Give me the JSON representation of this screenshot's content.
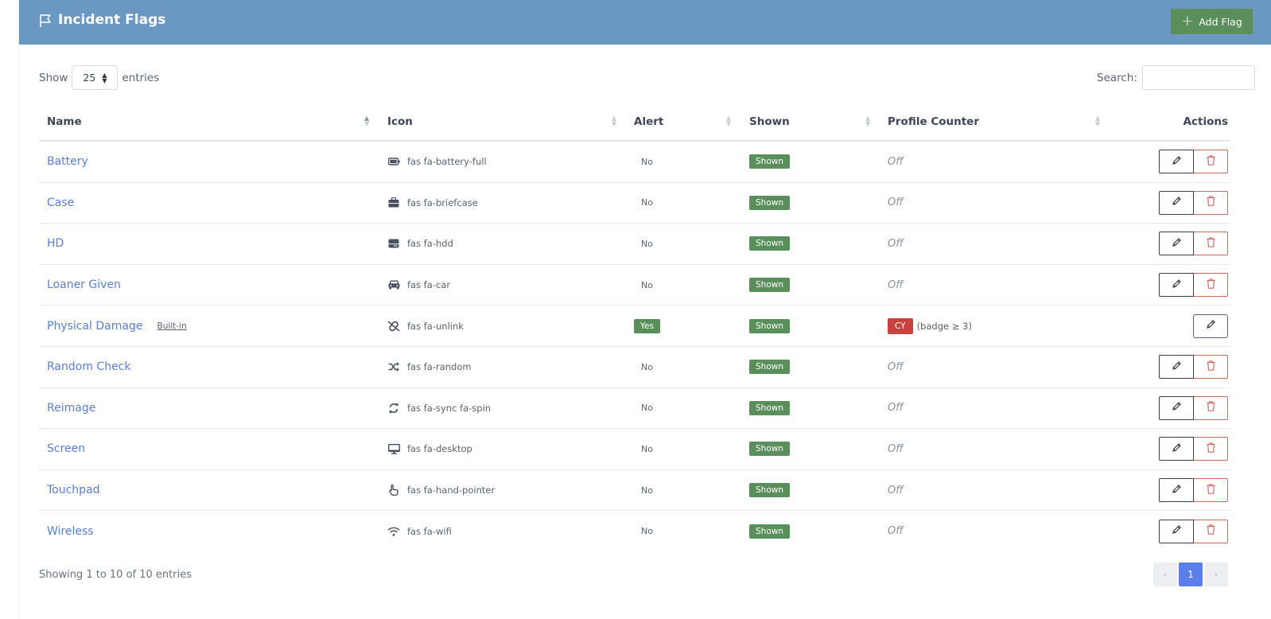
{
  "header": {
    "title": "Incident Flags",
    "add_label": "Add Flag"
  },
  "length_menu": {
    "show_label": "Show",
    "value": "25",
    "entries_label": "entries"
  },
  "search": {
    "label": "Search:",
    "value": ""
  },
  "columns": [
    "Name",
    "Icon",
    "Alert",
    "Shown",
    "Profile Counter",
    "Actions"
  ],
  "rows": [
    {
      "name": "Battery",
      "builtin": "",
      "icon_name": "battery-full-icon",
      "icon": "fas fa-battery-full",
      "alert": "No",
      "shown": "Shown",
      "profile": "Off",
      "deletable": true
    },
    {
      "name": "Case",
      "builtin": "",
      "icon_name": "briefcase-icon",
      "icon": "fas fa-briefcase",
      "alert": "No",
      "shown": "Shown",
      "profile": "Off",
      "deletable": true
    },
    {
      "name": "HD",
      "builtin": "",
      "icon_name": "hdd-icon",
      "icon": "fas fa-hdd",
      "alert": "No",
      "shown": "Shown",
      "profile": "Off",
      "deletable": true
    },
    {
      "name": "Loaner Given",
      "builtin": "",
      "icon_name": "car-icon",
      "icon": "fas fa-car",
      "alert": "No",
      "shown": "Shown",
      "profile": "Off",
      "deletable": true
    },
    {
      "name": "Physical Damage",
      "builtin": "Built-in",
      "icon_name": "unlink-icon",
      "icon": "fas fa-unlink",
      "alert": "Yes",
      "shown": "Shown",
      "profile": "",
      "profile_badge": "CY",
      "profile_note": "(badge ≥ 3)",
      "deletable": false
    },
    {
      "name": "Random Check",
      "builtin": "",
      "icon_name": "random-icon",
      "icon": "fas fa-random",
      "alert": "No",
      "shown": "Shown",
      "profile": "Off",
      "deletable": true
    },
    {
      "name": "Reimage",
      "builtin": "",
      "icon_name": "sync-icon",
      "icon": "fas fa-sync fa-spin",
      "alert": "No",
      "shown": "Shown",
      "profile": "Off",
      "deletable": true
    },
    {
      "name": "Screen",
      "builtin": "",
      "icon_name": "desktop-icon",
      "icon": "fas fa-desktop",
      "alert": "No",
      "shown": "Shown",
      "profile": "Off",
      "deletable": true
    },
    {
      "name": "Touchpad",
      "builtin": "",
      "icon_name": "hand-pointer-icon",
      "icon": "fas fa-hand-pointer",
      "alert": "No",
      "shown": "Shown",
      "profile": "Off",
      "deletable": true
    },
    {
      "name": "Wireless",
      "builtin": "",
      "icon_name": "wifi-icon",
      "icon": "fas fa-wifi",
      "alert": "No",
      "shown": "Shown",
      "profile": "Off",
      "deletable": true
    }
  ],
  "footer": {
    "info": "Showing 1 to 10 of 10 entries",
    "prev": "‹",
    "page": "1",
    "next": "›"
  },
  "colors": {
    "header_bg": "#6a98c3",
    "success": "#5a8f5c",
    "danger": "#c8413d",
    "link": "#5b7fcf",
    "page_active": "#5b7fe8"
  }
}
